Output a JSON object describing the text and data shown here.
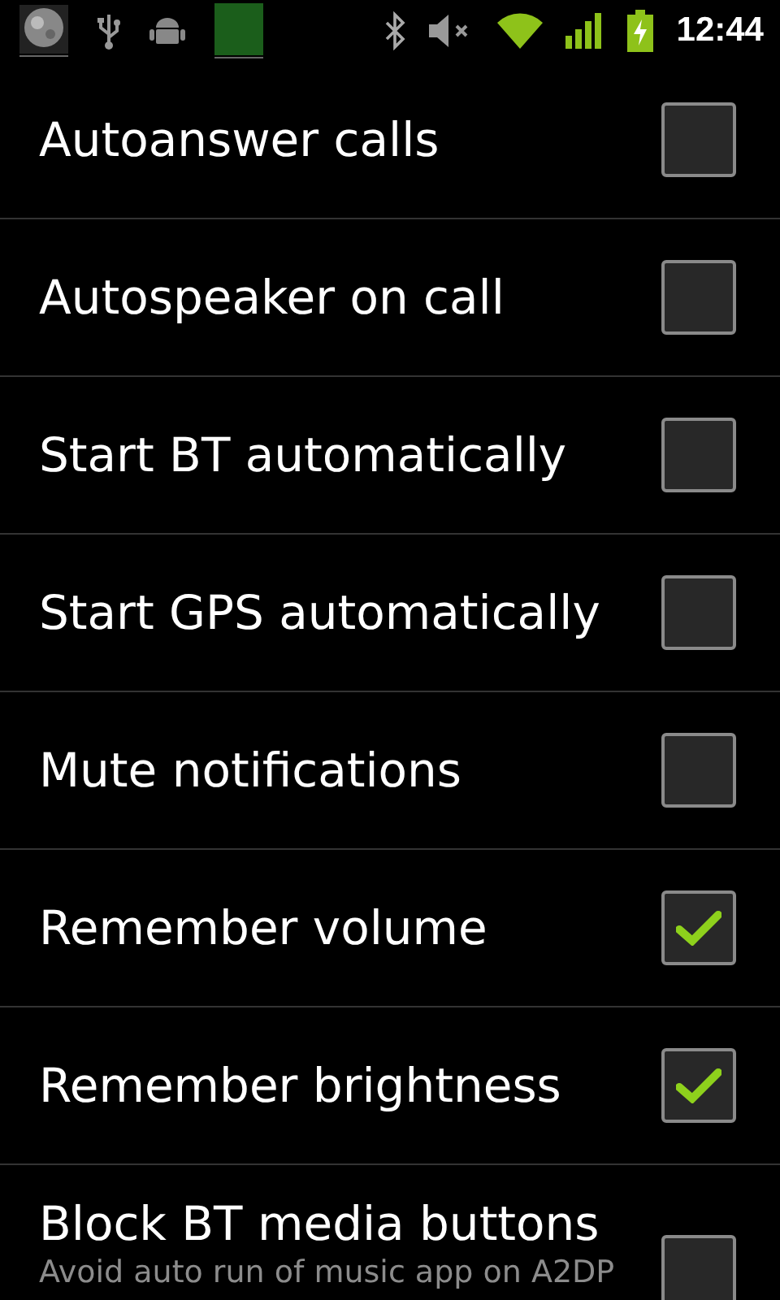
{
  "status_bar": {
    "time": "12:44"
  },
  "settings": [
    {
      "title": "Autoanswer calls",
      "checked": false
    },
    {
      "title": "Autospeaker on call",
      "checked": false
    },
    {
      "title": "Start BT automatically",
      "checked": false
    },
    {
      "title": "Start GPS automatically",
      "checked": false
    },
    {
      "title": "Mute notifications",
      "checked": false
    },
    {
      "title": "Remember volume",
      "checked": true
    },
    {
      "title": "Remember brightness",
      "checked": true
    },
    {
      "title": "Block BT media buttons",
      "summary": "Avoid auto run of music app on A2DP",
      "checked": false
    }
  ]
}
